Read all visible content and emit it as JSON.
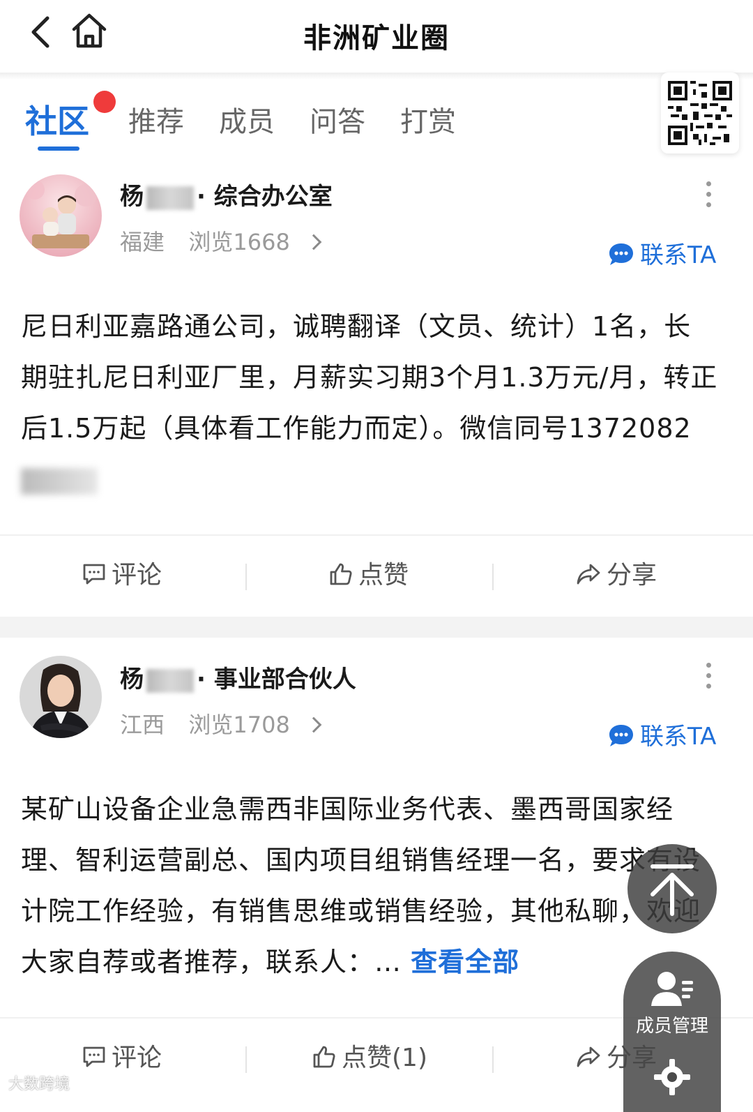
{
  "header": {
    "title": "非洲矿业圈"
  },
  "tabs": [
    {
      "label": "社区",
      "active": true,
      "has_dot": true
    },
    {
      "label": "推荐"
    },
    {
      "label": "成员"
    },
    {
      "label": "问答"
    },
    {
      "label": "打赏"
    }
  ],
  "posts": [
    {
      "author_prefix": "杨",
      "author_suffix": "· 综合办公室",
      "location": "福建",
      "views": "浏览1668",
      "contact_label": "联系TA",
      "text": "尼日利亚嘉路通公司，诚聘翻译（文员、统计）1名，长期驻扎尼日利亚厂里，月薪实习期3个月1.3万元/月，转正后1.5万起（具体看工作能力而定）。微信同号1372082",
      "actions": {
        "comment": "评论",
        "like": "点赞",
        "share": "分享"
      }
    },
    {
      "author_prefix": "杨",
      "author_suffix": "· 事业部合伙人",
      "location": "江西",
      "views": "浏览1708",
      "contact_label": "联系TA",
      "text": "某矿山设备企业急需西非国际业务代表、墨西哥国家经理、智利运营副总、国内项目组销售经理一名，要求有设计院工作经验，有销售思维或销售经验，其他私聊，欢迎大家自荐或者推荐，联系人：…",
      "see_all": "查看全部",
      "actions": {
        "comment": "评论",
        "like": "点赞(1)",
        "share": "分享"
      }
    }
  ],
  "floating": {
    "member_mgmt_label": "成员管理"
  },
  "watermark": "大数跨境",
  "colors": {
    "accent": "#1f6fd9",
    "badge": "#ef3b3b",
    "float_bg": "#3c3c3c"
  },
  "icons": [
    "back-icon",
    "home-icon",
    "qr-code-icon",
    "more-icon",
    "chat-bubble-icon",
    "comment-icon",
    "thumb-up-icon",
    "share-icon",
    "back-to-top-icon",
    "member-icon",
    "gear-icon"
  ]
}
